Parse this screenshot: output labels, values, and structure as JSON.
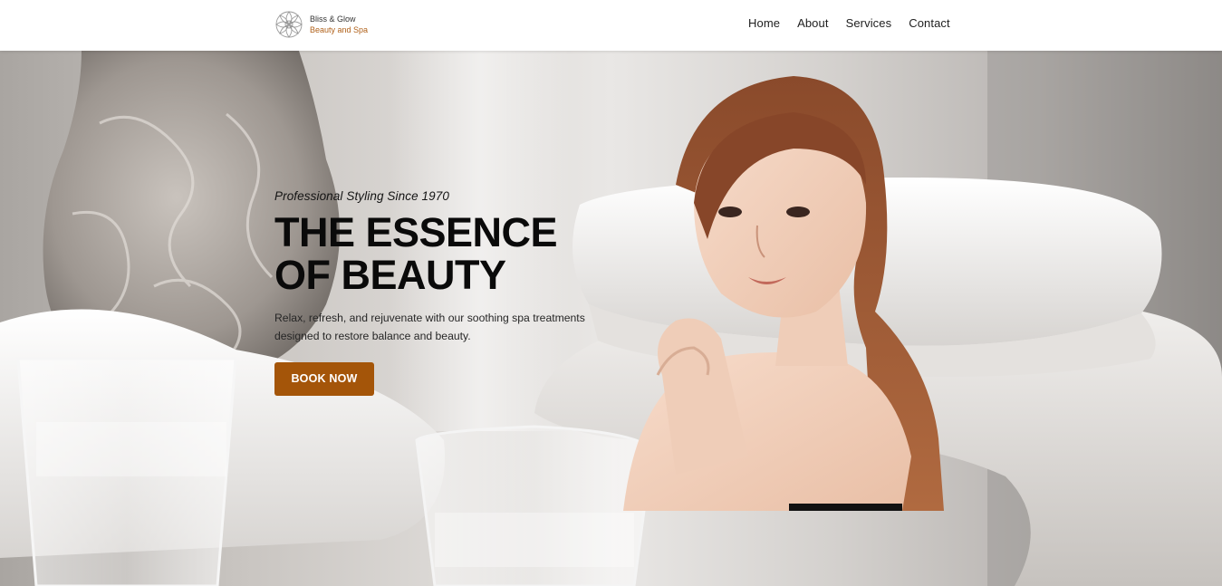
{
  "navbar": {
    "brand_name": "Bliss & Glow",
    "brand_tagline": "Beauty and Spa",
    "logo_icon": "mandala-flower-icon",
    "links": [
      {
        "label": "Home"
      },
      {
        "label": "About"
      },
      {
        "label": "Services"
      },
      {
        "label": "Contact"
      }
    ]
  },
  "hero": {
    "kicker": "Professional Styling Since 1970",
    "title_line1": "THE ESSENCE",
    "title_line2": "OF BEAUTY",
    "description": "Relax, refresh, and rejuvenate with our soothing spa treatments designed to restore balance and beauty.",
    "cta_label": "BOOK NOW",
    "background_image": "spa-still-life-vase-towels-glasses",
    "foreground_image": "woman-portrait-cutout"
  },
  "colors": {
    "accent": "#a45509",
    "tagline": "#b0611a",
    "nav_text": "#1e1e1e",
    "heading": "#0a0a0a"
  }
}
